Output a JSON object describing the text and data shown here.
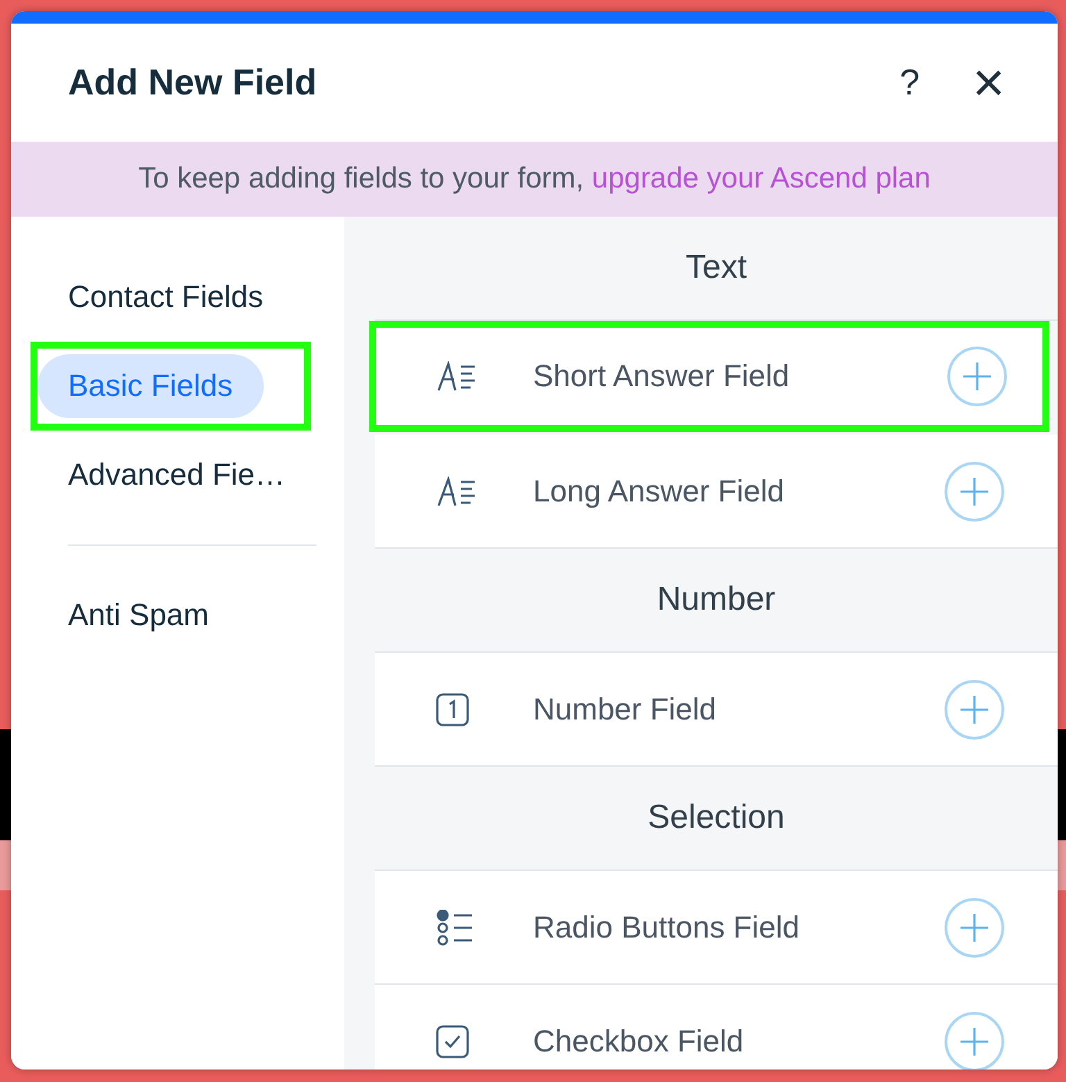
{
  "dialog": {
    "title": "Add New Field",
    "help": "?",
    "close": "×"
  },
  "banner": {
    "text": "To keep adding fields to your form,",
    "link": "upgrade your Ascend plan"
  },
  "sidebar": {
    "items": [
      {
        "label": "Contact Fields",
        "selected": false,
        "highlighted": false
      },
      {
        "label": "Basic Fields",
        "selected": true,
        "highlighted": true
      },
      {
        "label": "Advanced Fie…",
        "selected": false,
        "highlighted": false
      }
    ],
    "footer_items": [
      {
        "label": "Anti Spam",
        "selected": false
      }
    ]
  },
  "sections": [
    {
      "title": "Text",
      "fields": [
        {
          "label": "Short Answer Field",
          "kind": "text",
          "highlighted": true
        },
        {
          "label": "Long Answer Field",
          "kind": "text",
          "highlighted": false
        }
      ]
    },
    {
      "title": "Number",
      "fields": [
        {
          "label": "Number Field",
          "kind": "number",
          "highlighted": false
        }
      ]
    },
    {
      "title": "Selection",
      "fields": [
        {
          "label": "Radio Buttons Field",
          "kind": "radio",
          "highlighted": false
        },
        {
          "label": "Checkbox Field",
          "kind": "checkbox",
          "highlighted": false
        }
      ]
    }
  ]
}
